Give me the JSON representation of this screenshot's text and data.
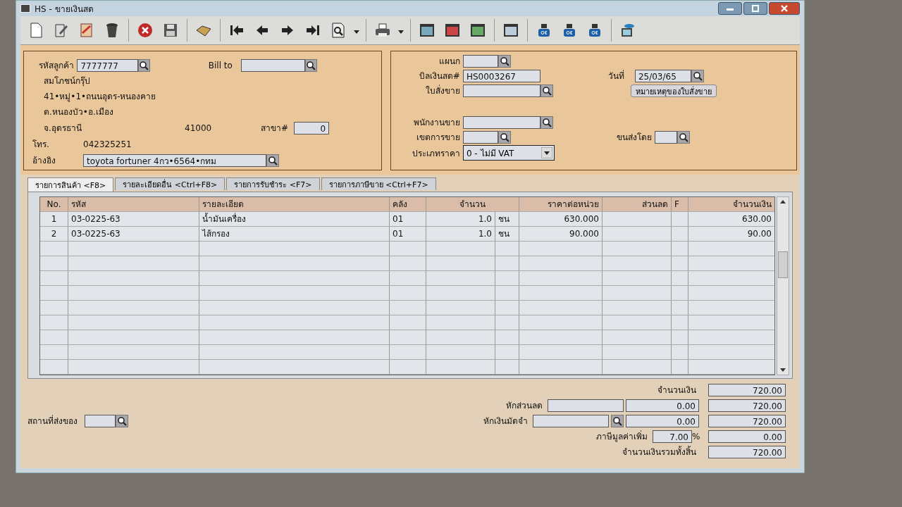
{
  "window": {
    "title": "HS - ขายเงินสด"
  },
  "customer": {
    "code_label": "รหัสลูกค้า",
    "code": "7777777",
    "bill_to_label": "Bill to",
    "name": "สมโภชน์กรุ๊ป",
    "address1": "41•หมู่•1•ถนนอุดร-หนองคาย",
    "address2": "ต.หนองบัว•อ.เมือง",
    "province": "จ.อุดรธานี",
    "postcode": "41000",
    "branch_label": "สาขา#",
    "branch": "0",
    "phone_label": "โทร.",
    "phone": "042325251",
    "ref_label": "อ้างอิง",
    "ref": "toyota fortuner 4กว•6564•กทม"
  },
  "document": {
    "dept_label": "แผนก",
    "bill_label": "บิลเงินสด#",
    "bill_no": "HS0003267",
    "date_label": "วันที่",
    "date": "25/03/65",
    "order_label": "ใบสั่งขาย",
    "note_button": "หมายเหตุของใบสั่งขาย",
    "sales_label": "พนักงานขาย",
    "area_label": "เขตการขาย",
    "ship_label": "ขนส่งโดย",
    "price_type_label": "ประเภทราคา",
    "price_type": "0 - ไม่มี VAT"
  },
  "tabs": [
    {
      "label": "รายการสินค้า <F8>",
      "selected": true
    },
    {
      "label": "รายละเอียดอื่น  <Ctrl+F8>",
      "selected": false
    },
    {
      "label": "รายการรับชำระ <F7>",
      "selected": false
    },
    {
      "label": "รายการภาษีขาย <Ctrl+F7>",
      "selected": false
    }
  ],
  "table": {
    "columns": [
      "No.",
      "รหัส",
      "รายละเอียด",
      "คลัง",
      "จำนวน",
      "ราคาต่อหน่วย",
      "ส่วนลด",
      "F",
      "จำนวนเงิน"
    ],
    "rows": [
      {
        "no": "1",
        "code": "03-0225-63",
        "description": "น้ำมันเครื่อง",
        "warehouse": "01",
        "qty": "1.0",
        "unit": "ชน",
        "price": "630.000",
        "amount": "630.00"
      },
      {
        "no": "2",
        "code": "03-0225-63",
        "description": "ไส้กรอง",
        "warehouse": "01",
        "qty": "1.0",
        "unit": "ชน",
        "price": "90.000",
        "amount": "90.00"
      }
    ]
  },
  "footer": {
    "delivery_label": "สถานที่ส่งของ",
    "amount_label": "จำนวนเงิน",
    "amount": "720.00",
    "discount_label": "หักส่วนลด",
    "discount": "0.00",
    "after_discount": "720.00",
    "deposit_label": "หักเงินมัดจำ",
    "deposit": "0.00",
    "after_deposit": "720.00",
    "vat_label": "ภาษีมูลค่าเพิ่ม",
    "vat_rate": "7.00",
    "percent": "%",
    "vat": "0.00",
    "total_label": "จำนวนเงินรวมทั้งสิ้น",
    "total": "720.00"
  }
}
